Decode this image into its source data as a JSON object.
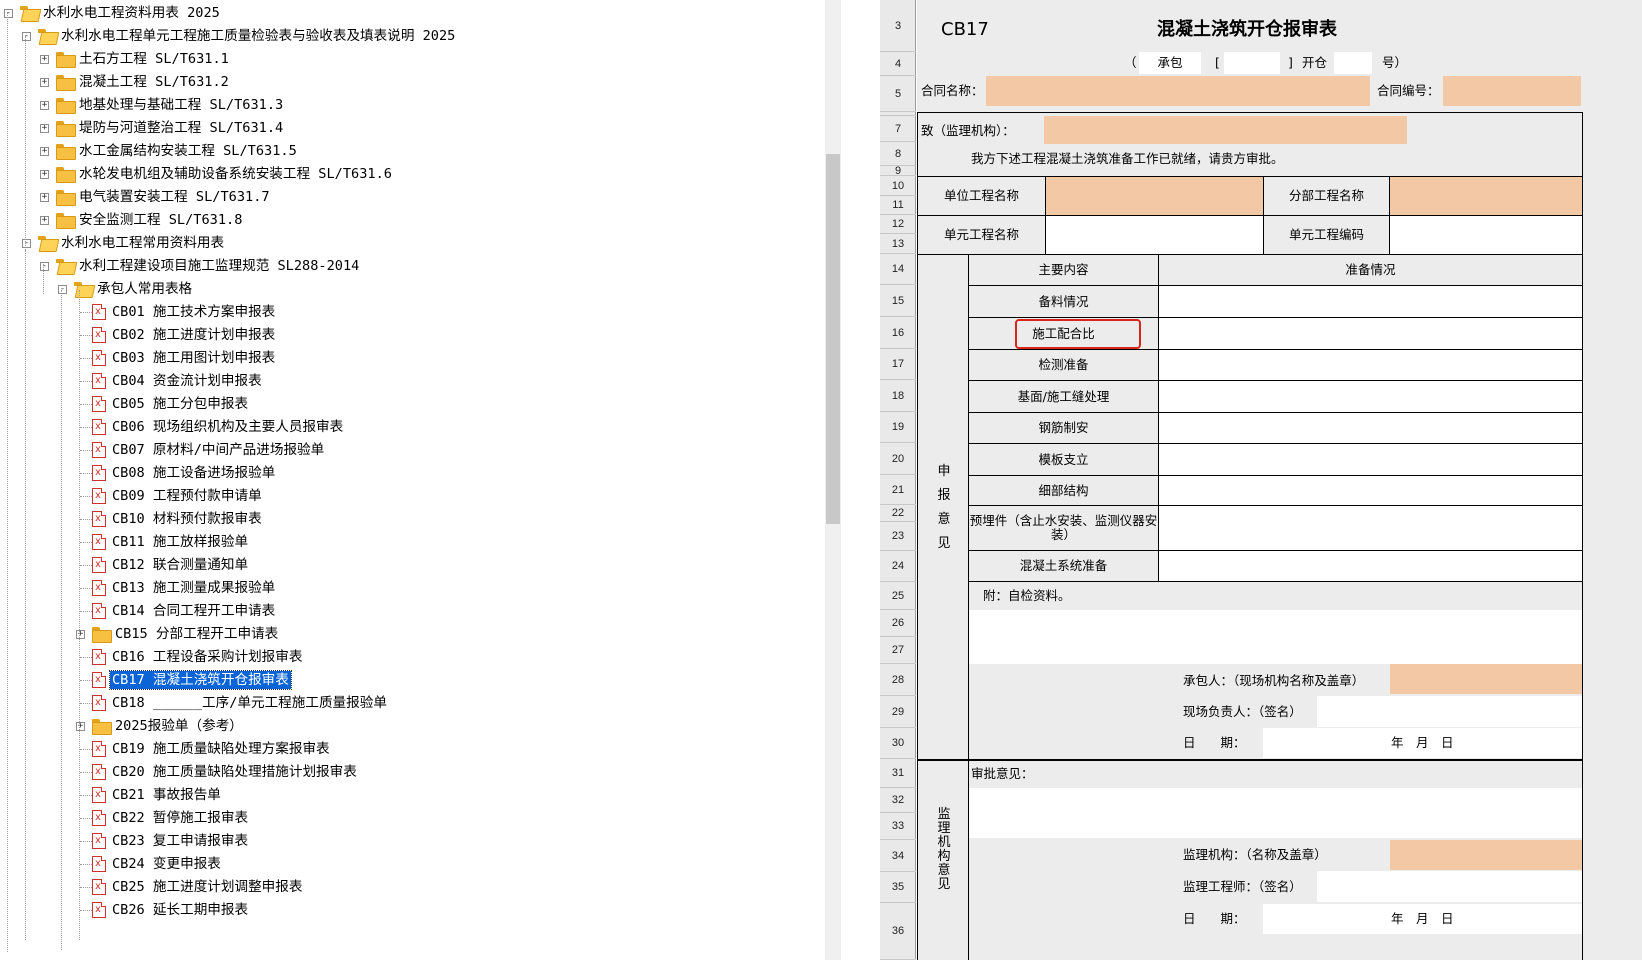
{
  "tree": [
    {
      "label": "水利水电工程资料用表 2025",
      "kind": "folder-open",
      "toggle": "-"
    },
    {
      "label": "水利水电工程单元工程施工质量检验表与验收表及填表说明 2025",
      "kind": "folder-open",
      "toggle": "-"
    },
    {
      "label": "土石方工程 SL/T631.1",
      "kind": "folder",
      "toggle": "+"
    },
    {
      "label": "混凝土工程 SL/T631.2",
      "kind": "folder",
      "toggle": "+"
    },
    {
      "label": "地基处理与基础工程 SL/T631.3",
      "kind": "folder",
      "toggle": "+"
    },
    {
      "label": "堤防与河道整治工程 SL/T631.4",
      "kind": "folder",
      "toggle": "+"
    },
    {
      "label": "水工金属结构安装工程 SL/T631.5",
      "kind": "folder",
      "toggle": "+"
    },
    {
      "label": "水轮发电机组及辅助设备系统安装工程 SL/T631.6",
      "kind": "folder",
      "toggle": "+"
    },
    {
      "label": "电气装置安装工程 SL/T631.7",
      "kind": "folder",
      "toggle": "+"
    },
    {
      "label": "安全监测工程 SL/T631.8",
      "kind": "folder",
      "toggle": "+"
    },
    {
      "label": "水利水电工程常用资料用表",
      "kind": "folder-open",
      "toggle": "-"
    },
    {
      "label": "水利工程建设项目施工监理规范 SL288-2014",
      "kind": "folder-open",
      "toggle": "-"
    },
    {
      "label": "承包人常用表格",
      "kind": "folder-open",
      "toggle": "-"
    },
    {
      "label": "CB01 施工技术方案申报表",
      "kind": "file"
    },
    {
      "label": "CB02 施工进度计划申报表",
      "kind": "file"
    },
    {
      "label": "CB03 施工用图计划申报表",
      "kind": "file"
    },
    {
      "label": "CB04 资金流计划申报表",
      "kind": "file"
    },
    {
      "label": "CB05 施工分包申报表",
      "kind": "file"
    },
    {
      "label": "CB06 现场组织机构及主要人员报审表",
      "kind": "file"
    },
    {
      "label": "CB07 原材料/中间产品进场报验单",
      "kind": "file"
    },
    {
      "label": "CB08 施工设备进场报验单",
      "kind": "file"
    },
    {
      "label": "CB09 工程预付款申请单",
      "kind": "file"
    },
    {
      "label": "CB10 材料预付款报审表",
      "kind": "file"
    },
    {
      "label": "CB11 施工放样报验单",
      "kind": "file"
    },
    {
      "label": "CB12 联合测量通知单",
      "kind": "file"
    },
    {
      "label": "CB13 施工测量成果报验单",
      "kind": "file"
    },
    {
      "label": "CB14 合同工程开工申请表",
      "kind": "file"
    },
    {
      "label": "CB15 分部工程开工申请表",
      "kind": "folder",
      "toggle": "+"
    },
    {
      "label": "CB16 工程设备采购计划报审表",
      "kind": "file"
    },
    {
      "label": "CB17 混凝土浇筑开仓报审表",
      "kind": "file",
      "selected": true
    },
    {
      "label": "CB18 ______工序/单元工程施工质量报验单",
      "kind": "file"
    },
    {
      "label": "2025报验单（参考）",
      "kind": "folder",
      "toggle": "+"
    },
    {
      "label": "CB19 施工质量缺陷处理方案报审表",
      "kind": "file"
    },
    {
      "label": "CB20 施工质量缺陷处理措施计划报审表",
      "kind": "file"
    },
    {
      "label": "CB21 事故报告单",
      "kind": "file"
    },
    {
      "label": "CB22 暂停施工报审表",
      "kind": "file"
    },
    {
      "label": "CB23 复工申请报审表",
      "kind": "file"
    },
    {
      "label": "CB24 变更申报表",
      "kind": "file"
    },
    {
      "label": "CB25 施工进度计划调整申报表",
      "kind": "file"
    },
    {
      "label": "CB26 延长工期申报表",
      "kind": "file"
    }
  ],
  "sheet": {
    "row_numbers": [
      "3",
      "4",
      "5",
      "",
      "7",
      "8",
      "9",
      "10",
      "11",
      "12",
      "13",
      "14",
      "15",
      "16",
      "17",
      "18",
      "19",
      "20",
      "21",
      "22",
      "23",
      "24",
      "25",
      "26",
      "27",
      "28",
      "29",
      "30",
      "31",
      "32",
      "33",
      "34",
      "35",
      "36"
    ],
    "code": "CB17",
    "title": "混凝土浇筑开仓报审表",
    "sub": {
      "open_paren": "（",
      "contractor": "承包",
      "lbracket": "[",
      "rbracket": "]",
      "kaicang": "开仓",
      "hao": "号）"
    },
    "contract_name_label": "合同名称：",
    "contract_no_label": "合同编号：",
    "to_label": "致（监理机构）：",
    "intro": "我方下述工程混凝土浇筑准备工作已就绪，请贵方审批。",
    "unit_project_label": "单位工程名称",
    "sub_project_label": "分部工程名称",
    "element_project_label": "单元工程名称",
    "element_code_label": "单元工程编码",
    "header_main": "主要内容",
    "header_prep": "准备情况",
    "items": [
      "备料情况",
      "施工配合比",
      "检测准备",
      "基面/施工缝处理",
      "钢筋制安",
      "模板支立",
      "细部结构",
      "预埋件（含止水安装、监测仪器安装）",
      "混凝土系统准备"
    ],
    "side_apply": [
      "申",
      "报",
      "意",
      "见"
    ],
    "attachment": "附：自检资料。",
    "contractor_sign": "承包人：（现场机构名称及盖章）",
    "site_manager": "现场负责人：（签名）",
    "date_label": "日　　期：",
    "date_ymd": "年　月　日",
    "approval_label": "审批意见：",
    "side_supervisor": [
      "监",
      "理",
      "机",
      "构",
      "意",
      "见"
    ],
    "supervisor_org": "监理机构：（名称及盖章）",
    "supervisor_eng": "监理工程师：（签名）",
    "date_label2": "日　　期：",
    "date_ymd2": "年　月　日"
  },
  "colors": {
    "peach": "#f2c9a4",
    "selection": "#0a64d6",
    "highlight": "#d9261c"
  }
}
